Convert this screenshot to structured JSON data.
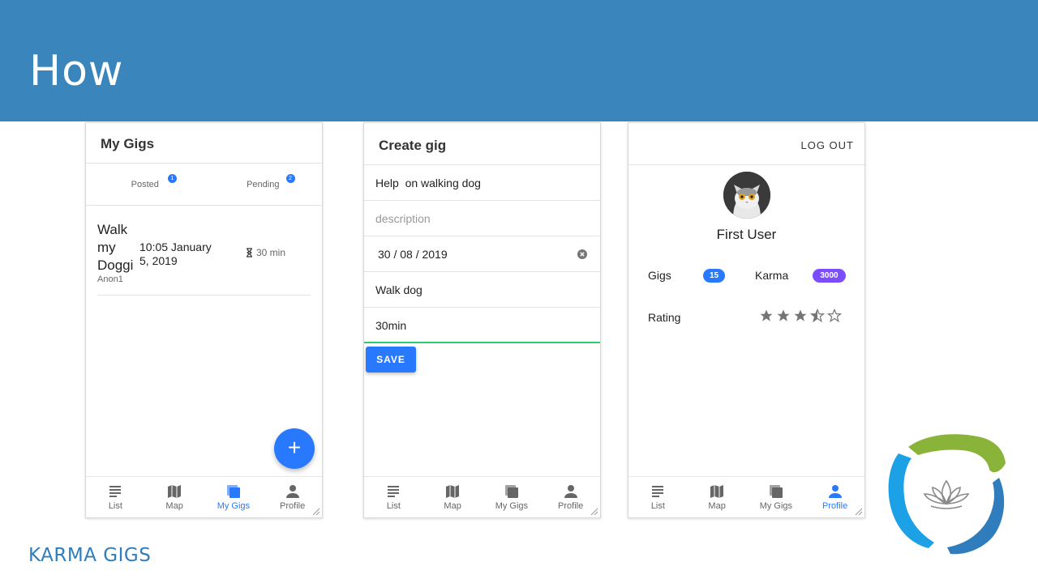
{
  "slide": {
    "title": "How",
    "footer": "KARMA GIGS"
  },
  "colors": {
    "header_bg": "#3a85bb",
    "accent": "#2979ff",
    "karma_badge": "#7c4dff",
    "focus_underline": "#2ecc71"
  },
  "nav": {
    "list": "List",
    "map": "Map",
    "my_gigs": "My Gigs",
    "profile": "Profile"
  },
  "my_gigs_screen": {
    "title": "My Gigs",
    "tabs": [
      {
        "label": "Posted",
        "badge": "1"
      },
      {
        "label": "Pending",
        "badge": "2"
      }
    ],
    "gig": {
      "title": "Walk my Doggi",
      "user": "Anon1",
      "date": "10:05 January 5, 2019",
      "duration": "30 min"
    },
    "fab_icon": "+",
    "active_nav": "my_gigs"
  },
  "create_gig_screen": {
    "title": "Create gig",
    "fields": {
      "title_value": "Help  on walking dog",
      "description_placeholder": "description",
      "date_value": "30 / 08 / 2019",
      "category_value": "Walk dog",
      "duration_value": "30min"
    },
    "save_label": "SAVE"
  },
  "profile_screen": {
    "logout_label": "LOG OUT",
    "user_name": "First User",
    "gigs_label": "Gigs",
    "gigs_count": "15",
    "karma_label": "Karma",
    "karma_count": "3000",
    "rating_label": "Rating",
    "rating_value": 3.5,
    "rating_max": 5,
    "active_nav": "profile"
  }
}
